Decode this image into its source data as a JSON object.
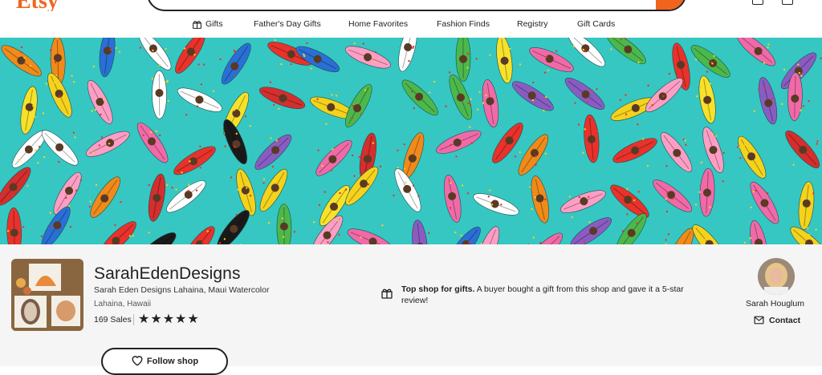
{
  "header": {
    "logo": "Etsy",
    "partial_link": "",
    "search_value": ""
  },
  "nav": {
    "items": [
      {
        "label": "Gifts",
        "icon": "gift-icon"
      },
      {
        "label": "Father's Day Gifts"
      },
      {
        "label": "Home Favorites"
      },
      {
        "label": "Fashion Finds"
      },
      {
        "label": "Registry"
      },
      {
        "label": "Gift Cards"
      }
    ]
  },
  "banner": {
    "description_icon": "surfboards-watercolor-banner"
  },
  "shop": {
    "name": "SarahEdenDesigns",
    "tagline": "Sarah Eden Designs Lahaina, Maui Watercolor",
    "location": "Lahaina, Hawaii",
    "sales": "169 Sales",
    "rating_stars": 5,
    "follow_label": "Follow shop"
  },
  "top_shop": {
    "title": "Top shop for gifts.",
    "body": "A buyer bought a gift from this shop and gave it a 5-star review!"
  },
  "owner": {
    "name": "Sarah Houglum",
    "contact_label": "Contact"
  },
  "colors": {
    "brand": "#f1641e",
    "banner_water": "#36c7c3",
    "panel_bg": "#f5f5f5"
  }
}
